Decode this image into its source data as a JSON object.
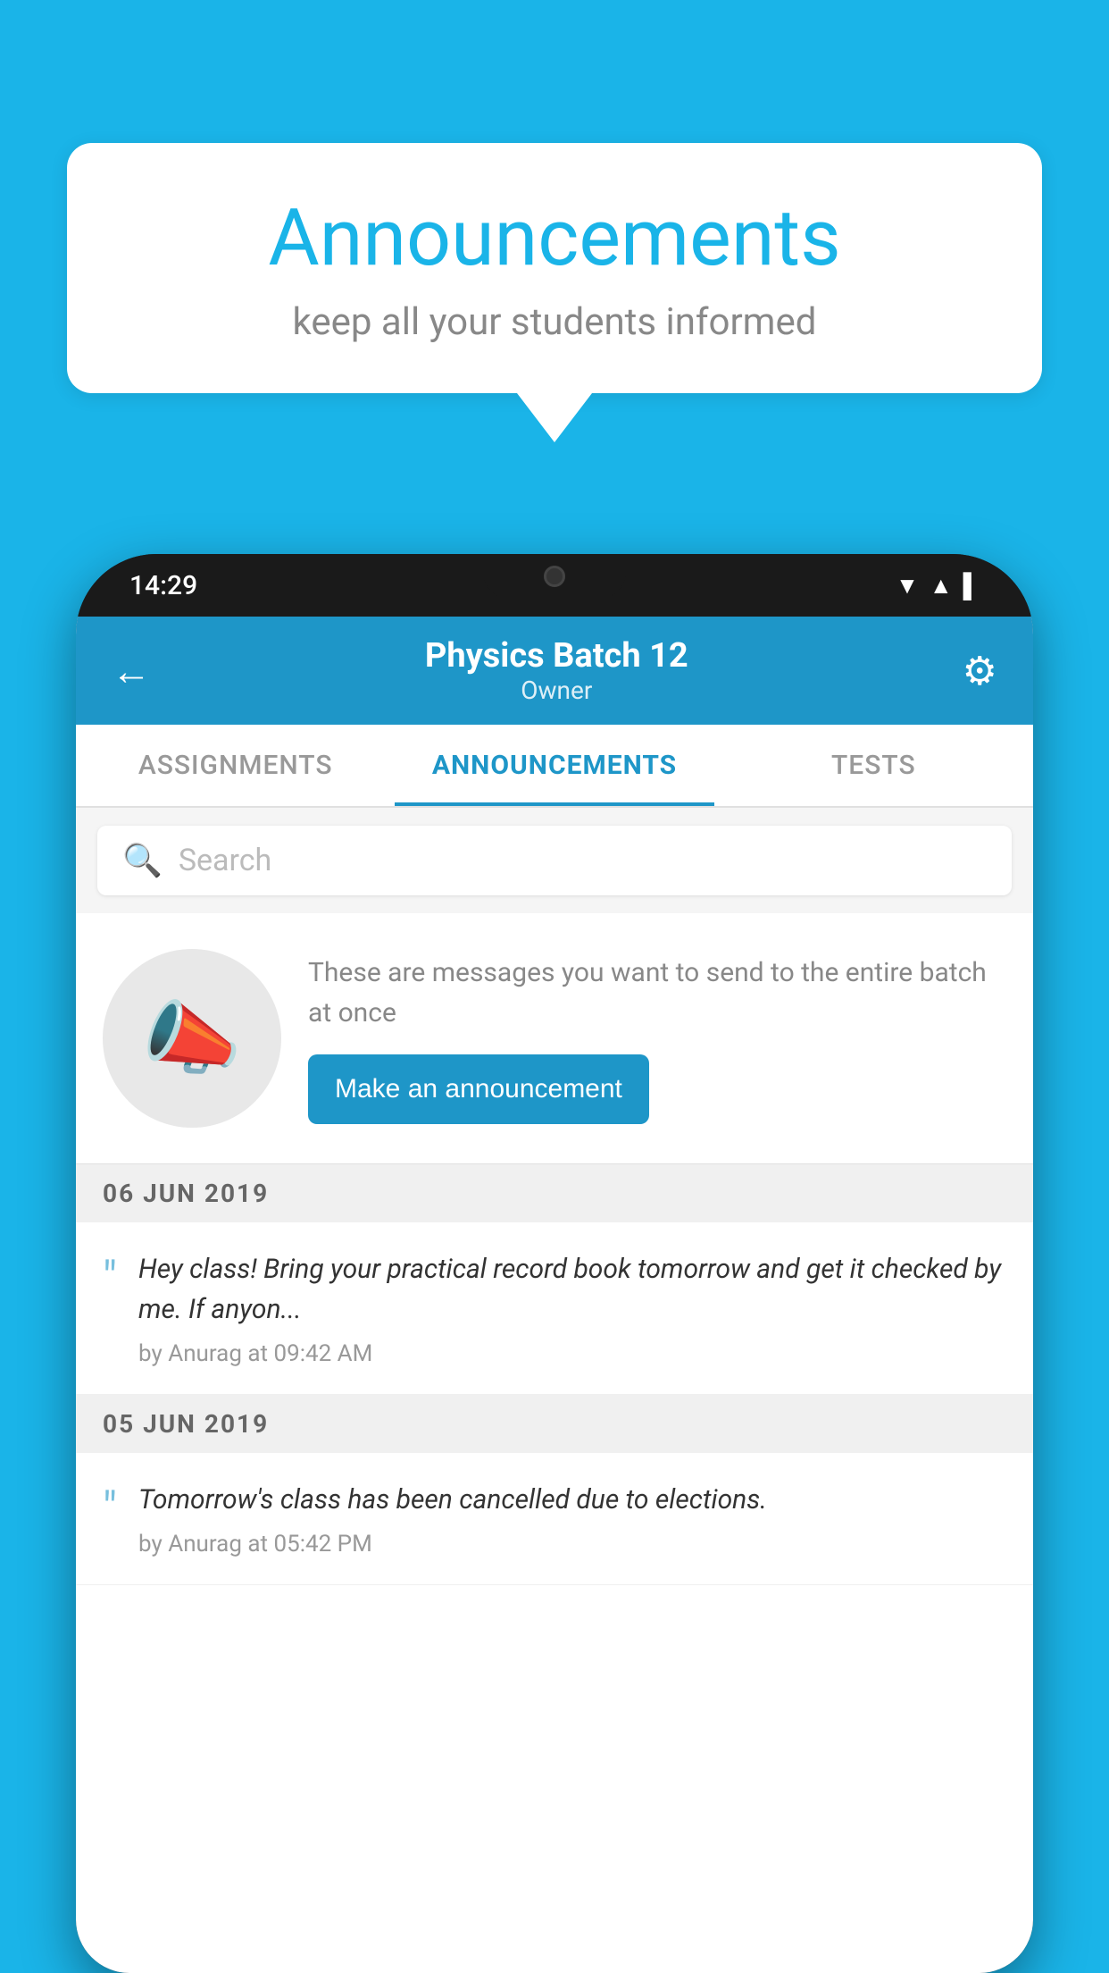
{
  "background_color": "#1ab4e8",
  "speech_bubble": {
    "title": "Announcements",
    "subtitle": "keep all your students informed"
  },
  "phone": {
    "status_bar": {
      "time": "14:29"
    },
    "header": {
      "title": "Physics Batch 12",
      "subtitle": "Owner",
      "back_label": "←",
      "settings_label": "⚙"
    },
    "tabs": [
      {
        "label": "ASSIGNMENTS",
        "active": false
      },
      {
        "label": "ANNOUNCEMENTS",
        "active": true
      },
      {
        "label": "TESTS",
        "active": false
      }
    ],
    "search": {
      "placeholder": "Search"
    },
    "empty_state": {
      "description": "These are messages you want to send to the entire batch at once",
      "cta_label": "Make an announcement"
    },
    "announcements": [
      {
        "date": "06  JUN  2019",
        "text": "Hey class! Bring your practical record book tomorrow and get it checked by me. If anyon...",
        "meta": "by Anurag at 09:42 AM"
      },
      {
        "date": "05  JUN  2019",
        "text": "Tomorrow's class has been cancelled due to elections.",
        "meta": "by Anurag at 05:42 PM"
      }
    ]
  }
}
